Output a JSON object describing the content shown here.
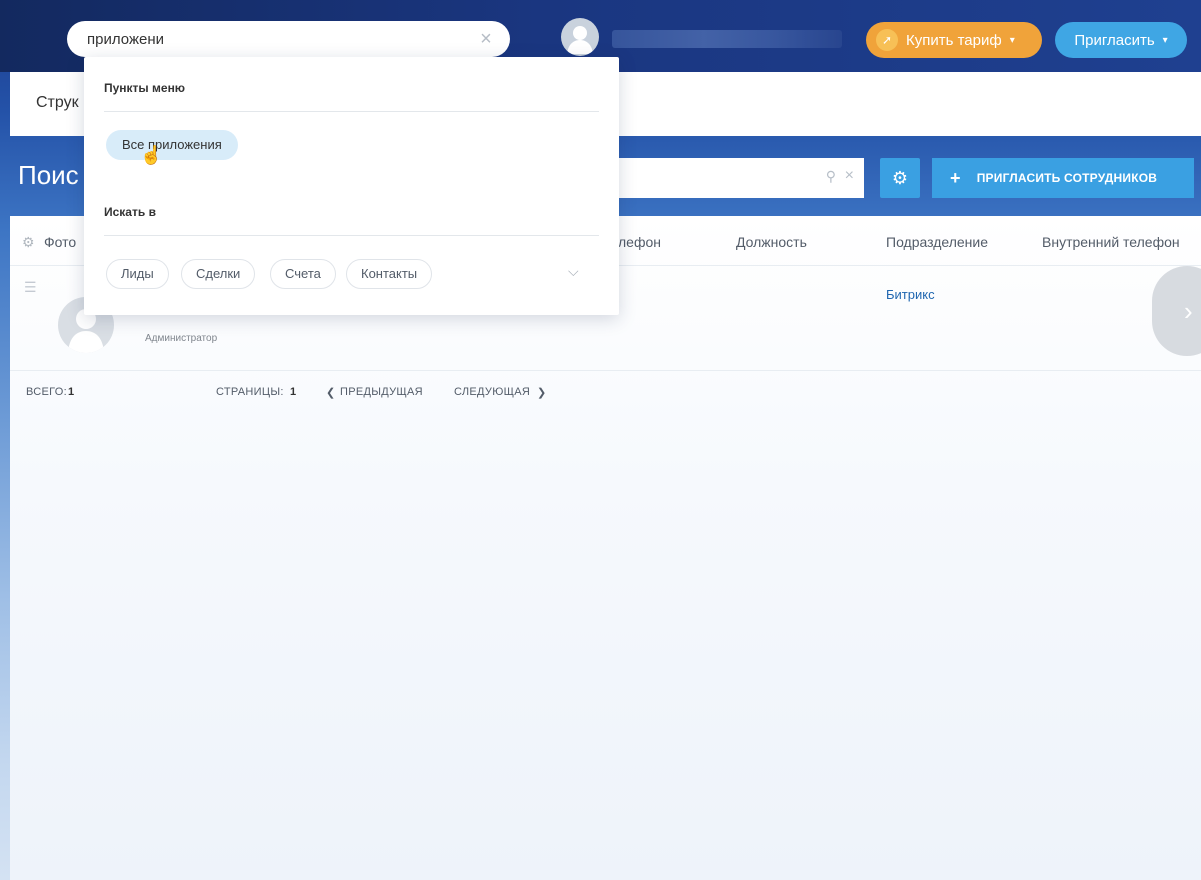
{
  "header": {
    "search_value": "приложени",
    "buy_label": "Купить тариф",
    "invite_label": "Пригласить"
  },
  "breadcrumb": {
    "title": "Струк"
  },
  "toolbar": {
    "page_title": "Поис",
    "invite_staff_label": "ПРИГЛАСИТЬ СОТРУДНИКОВ"
  },
  "grid": {
    "columns": [
      "Фото",
      "лефон",
      "Должность",
      "Подразделение",
      "Внутренний телефон"
    ],
    "rows": [
      {
        "role": "Администратор",
        "department": "Битрикс"
      }
    ]
  },
  "pager": {
    "total_label": "ВСЕГО:",
    "total_value": "1",
    "pages_label": "СТРАНИЦЫ:",
    "pages_value": "1",
    "prev_label": "ПРЕДЫДУЩАЯ",
    "next_label": "СЛЕДУЮЩАЯ"
  },
  "dropdown": {
    "menu_section_title": "Пункты меню",
    "menu_items": [
      "Все приложения"
    ],
    "search_in_title": "Искать в",
    "search_in_chips": [
      "Лиды",
      "Сделки",
      "Счета",
      "Контакты"
    ]
  },
  "colors": {
    "header_bg": "#1a3680",
    "buy_button": "#f0a33a",
    "invite_button": "#3fa6e4",
    "accent_blue": "#3aa0e2",
    "link_blue": "#2067b0"
  }
}
